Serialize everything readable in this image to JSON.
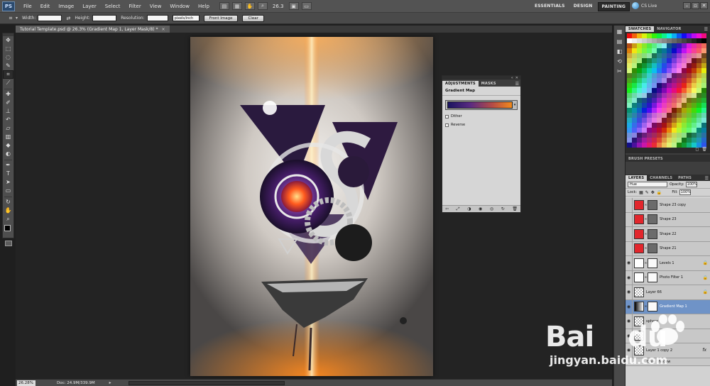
{
  "app": {
    "logo": "PS",
    "zoom": "26.3"
  },
  "menu": [
    "File",
    "Edit",
    "Image",
    "Layer",
    "Select",
    "Filter",
    "View",
    "Window",
    "Help"
  ],
  "workspaces": {
    "items": [
      "ESSENTIALS",
      "DESIGN",
      "PAINTING"
    ],
    "active": "PAINTING",
    "more": "»"
  },
  "cslive": "CS Live",
  "window_controls": {
    "minimize": "–",
    "restore": "▫",
    "close": "✕"
  },
  "options": {
    "width_label": "Width:",
    "height_label": "Height:",
    "resolution_label": "Resolution:",
    "resolution_unit": "pixels/inch",
    "front_image": "Front Image",
    "clear": "Clear"
  },
  "document": {
    "tab_title": "Tutorial Template.psd @ 26.3% (Gradient Map 1, Layer Mask/8) *",
    "close": "×"
  },
  "status": {
    "zoom": "26.28%",
    "doc": "Doc: 24.9M/339.9M",
    "arrow": "▸"
  },
  "adjustments": {
    "tabs": [
      "ADJUSTMENTS",
      "MASKS"
    ],
    "title": "Gradient Map",
    "dither": "Dither",
    "reverse": "Reverse",
    "dropdown": "▾"
  },
  "dock": {
    "swatches_tabs": [
      "SWATCHES",
      "NAVIGATOR"
    ],
    "brush_presets": "BRUSH PRESETS",
    "layers_tabs": [
      "LAYERS",
      "CHANNELS",
      "PATHS"
    ],
    "blend_mode": "Hue",
    "opacity_label": "Opacity:",
    "opacity_value": "100%",
    "lock_label": "Lock:",
    "fill_label": "Fill:",
    "fill_value": "100%"
  },
  "layers": [
    {
      "name": "Shape 23 copy",
      "thumb": "t-red",
      "mask": "t-gray",
      "visible": false,
      "lock": false,
      "selected": false
    },
    {
      "name": "Shape 23",
      "thumb": "t-red",
      "mask": "t-gray",
      "visible": false,
      "lock": false,
      "selected": false
    },
    {
      "name": "Shape 22",
      "thumb": "t-red",
      "mask": "t-gray",
      "visible": false,
      "lock": false,
      "selected": false
    },
    {
      "name": "Shape 21",
      "thumb": "t-red",
      "mask": "t-gray",
      "visible": false,
      "lock": false,
      "selected": false
    },
    {
      "name": "Levels 1",
      "thumb": "t-levels",
      "mask": "t-white",
      "visible": true,
      "lock": true,
      "selected": false
    },
    {
      "name": "Photo Filter 1",
      "thumb": "t-photo",
      "mask": "t-white",
      "visible": true,
      "lock": true,
      "selected": false
    },
    {
      "name": "Layer 66",
      "thumb": "t-check",
      "mask": "",
      "visible": true,
      "lock": true,
      "selected": false
    },
    {
      "name": "Gradient Map 1",
      "thumb": "t-grad",
      "mask": "t-white",
      "visible": true,
      "lock": false,
      "selected": true
    },
    {
      "name": "sphere",
      "thumb": "t-check",
      "mask": "",
      "visible": true,
      "lock": false,
      "selected": false
    },
    {
      "name": "",
      "thumb": "t-check",
      "mask": "",
      "visible": true,
      "lock": false,
      "selected": false
    },
    {
      "name": "Layer 1 copy 2",
      "thumb": "t-check",
      "mask": "",
      "visible": true,
      "lock": false,
      "selected": false,
      "fx": "fx"
    }
  ],
  "layer_effect": "Drop Shadow",
  "watermark": {
    "brand": "Bai",
    "brand2": "du",
    "url": "jingyan.baidu.com"
  }
}
